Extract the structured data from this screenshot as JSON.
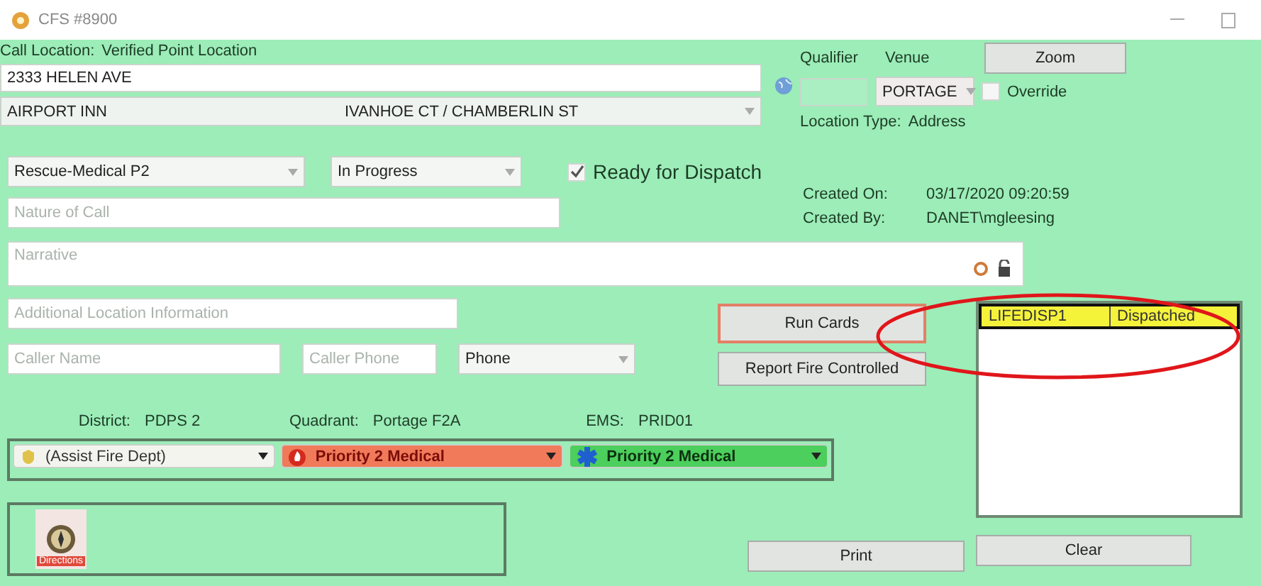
{
  "window": {
    "title": "CFS #8900"
  },
  "call_location": {
    "label": "Call Location:",
    "value": "Verified Point Location"
  },
  "address": {
    "value": "2333 HELEN AVE"
  },
  "common_place": {
    "value": "AIRPORT INN",
    "cross_street": "IVANHOE CT / CHAMBERLIN ST"
  },
  "qualifier": {
    "label": "Qualifier"
  },
  "venue": {
    "label": "Venue",
    "value": "PORTAGE"
  },
  "zoom_button": "Zoom",
  "override": {
    "label": "Override",
    "checked": false
  },
  "location_type": {
    "label": "Location Type:",
    "value": "Address"
  },
  "call_type": {
    "value": "Rescue-Medical P2"
  },
  "status": {
    "value": "In Progress"
  },
  "ready_for_dispatch": {
    "label": "Ready for Dispatch",
    "checked": true
  },
  "created": [
    {
      "label": "Created On:",
      "value": "03/17/2020 09:20:59"
    },
    {
      "label": "Created By:",
      "value": "DANET\\mgleesing"
    }
  ],
  "nature_of_call": {
    "placeholder": "Nature of Call"
  },
  "narrative": {
    "placeholder": "Narrative"
  },
  "additional_location": {
    "placeholder": "Additional Location Information"
  },
  "caller_name": {
    "placeholder": "Caller Name"
  },
  "caller_phone": {
    "placeholder": "Caller Phone"
  },
  "phone_type": {
    "value": "Phone"
  },
  "action_buttons": [
    {
      "label": "Run Cards",
      "highlighted": true
    },
    {
      "label": "Report Fire Controlled",
      "highlighted": false
    }
  ],
  "units": [
    {
      "unit": "LIFEDISP1",
      "status": "Dispatched",
      "selected": true
    }
  ],
  "zones": [
    {
      "label": "District:",
      "value": "PDPS 2"
    },
    {
      "label": "Quadrant:",
      "value": "Portage F2A"
    },
    {
      "label": "EMS:",
      "value": "PRID01"
    }
  ],
  "priorities": [
    {
      "kind": "police",
      "value": "(Assist Fire Dept)",
      "color": "#f4f4ee"
    },
    {
      "kind": "fire",
      "value": "Priority 2 Medical",
      "color": "#f07a5a"
    },
    {
      "kind": "medical",
      "value": "Priority 2 Medical",
      "color": "#4ccf5c"
    }
  ],
  "directions_button": "Directions",
  "footer_buttons": [
    "Print",
    "Clear"
  ]
}
